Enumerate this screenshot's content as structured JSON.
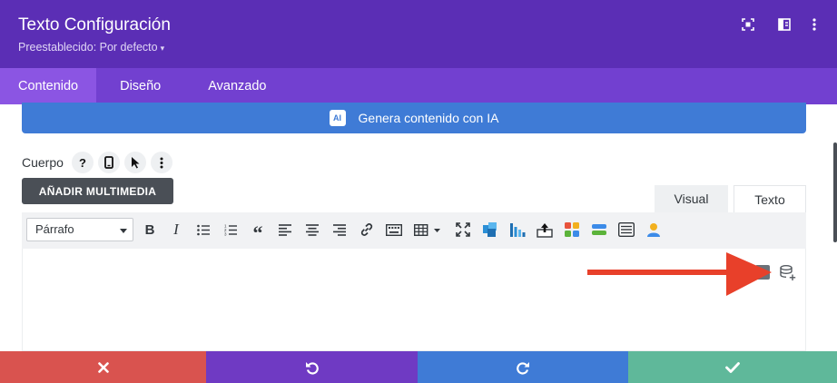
{
  "header": {
    "title": "Texto Configuración",
    "preset": "Preestablecido: Por defecto",
    "icons": [
      "focus-icon",
      "sidebar-layout-icon",
      "more-vertical-icon"
    ]
  },
  "tabs": [
    "Contenido",
    "Diseño",
    "Avanzado"
  ],
  "active_tab": "Contenido",
  "ai_bar": {
    "badge": "AI",
    "label": "Genera contenido con IA"
  },
  "body_field": {
    "label": "Cuerpo",
    "icons": [
      "help-icon",
      "mobile-icon",
      "cursor-icon",
      "more-vertical-icon"
    ]
  },
  "media_button": "AÑADIR MULTIMEDIA",
  "editor_tabs": {
    "visual": "Visual",
    "text": "Texto",
    "active": "Visual"
  },
  "toolbar": {
    "format_value": "Párrafo",
    "buttons": [
      "bold",
      "italic",
      "bullet-list",
      "numbered-list",
      "blockquote",
      "align-left",
      "align-center",
      "align-right",
      "link",
      "keyboard",
      "table",
      "fullscreen",
      "puzzle-plugin",
      "chart-plugin",
      "upload-plugin",
      "shapes-plugin",
      "divider-plugin",
      "toggle-plugin",
      "user-plugin"
    ]
  },
  "footer": {
    "buttons": [
      "cancel-icon",
      "undo-icon",
      "redo-icon",
      "save-icon"
    ],
    "colors": [
      "#d9534f",
      "#6f3ac3",
      "#3f7bd6",
      "#5fb89a"
    ]
  },
  "colors": {
    "header": "#5b2eb5",
    "tabs": "#7240d0",
    "active_tab": "#8b55e3",
    "ai_bar": "#3f7bd6",
    "annotation_arrow": "#e8402a"
  }
}
